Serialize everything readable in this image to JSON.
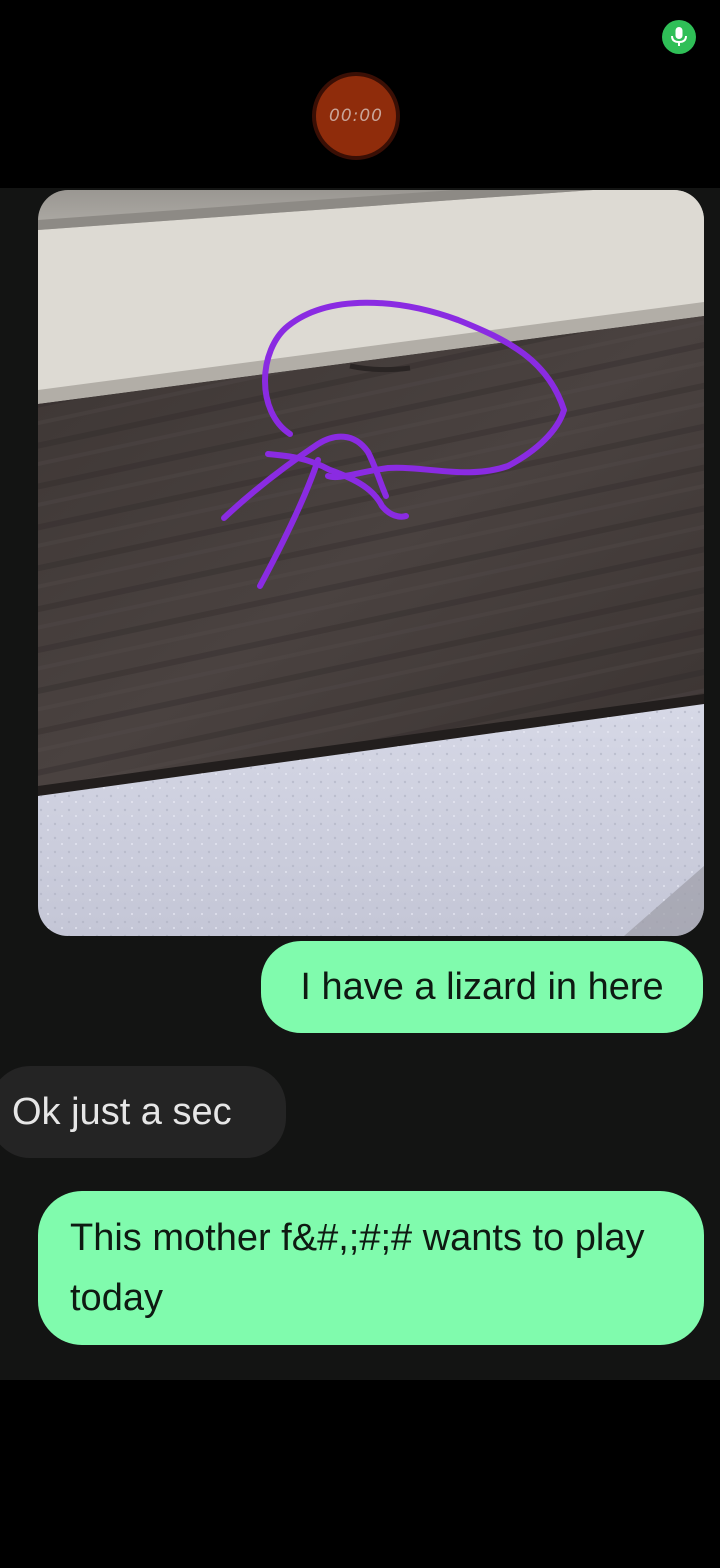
{
  "recording": {
    "timer": "00:00",
    "mic_icon": "microphone-icon",
    "status_color": "#2fbf57",
    "record_color": "#8f2c0b"
  },
  "conversation": {
    "photo_icon": "photo-with-drawing",
    "annotation_color": "#8a2be2",
    "messages": [
      {
        "direction": "sent",
        "text": "I have a lizard in here"
      },
      {
        "direction": "received",
        "text": "Ok just a sec"
      },
      {
        "direction": "sent",
        "text": "This mother f&#,;#;# wants to play today"
      }
    ],
    "sent_color": "#80fbad",
    "received_color": "#242424"
  }
}
